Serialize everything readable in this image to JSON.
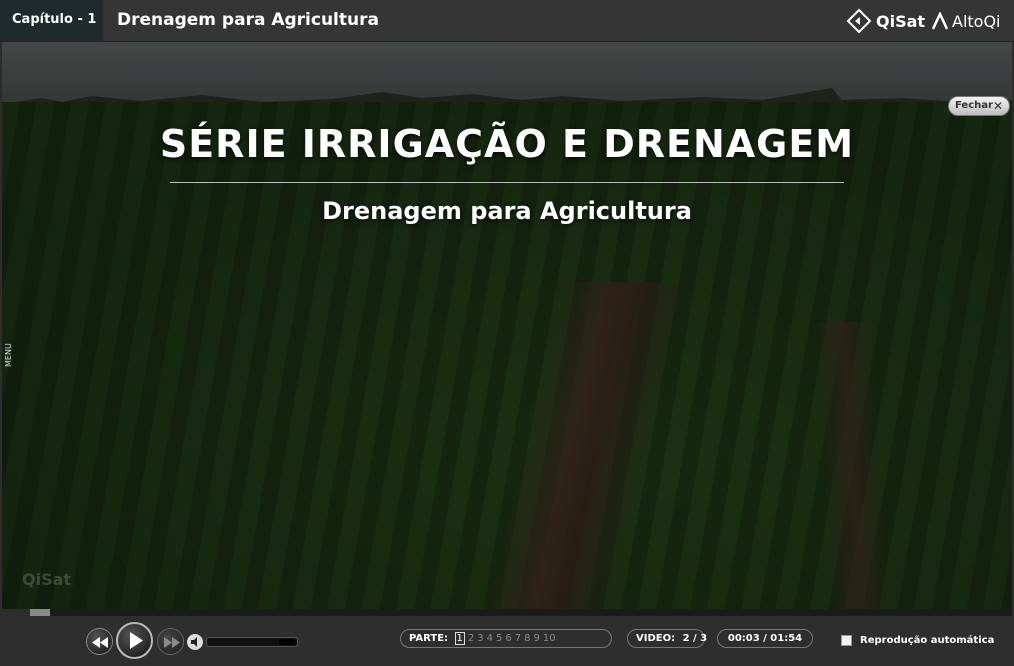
{
  "header": {
    "chapter": "Capítulo - 1",
    "title": "Drenagem para Agricultura",
    "brand_qisat": "QiSat",
    "brand_altoqi": "AltoQi"
  },
  "video": {
    "title": "SÉRIE IRRIGAÇÃO E DRENAGEM",
    "subtitle": "Drenagem para Agricultura",
    "menu_label": "MENU",
    "close_label": "Fechar",
    "watermark": "QiSat"
  },
  "playback": {
    "progress_fraction": 0.02
  },
  "controls": {
    "parts_label": "PARTE:",
    "parts": [
      "1",
      "2",
      "3",
      "4",
      "5",
      "6",
      "7",
      "8",
      "9",
      "10"
    ],
    "active_part": "1",
    "video_label": "VIDEO:",
    "video_value": "2 / 3",
    "time": "00:03 / 01:54",
    "autoplay_label": "Reprodução automática"
  },
  "colors": {
    "header_bg": "#353535",
    "chapter_bg": "#1f2a2a",
    "controls_bg": "#2e2e2e"
  }
}
